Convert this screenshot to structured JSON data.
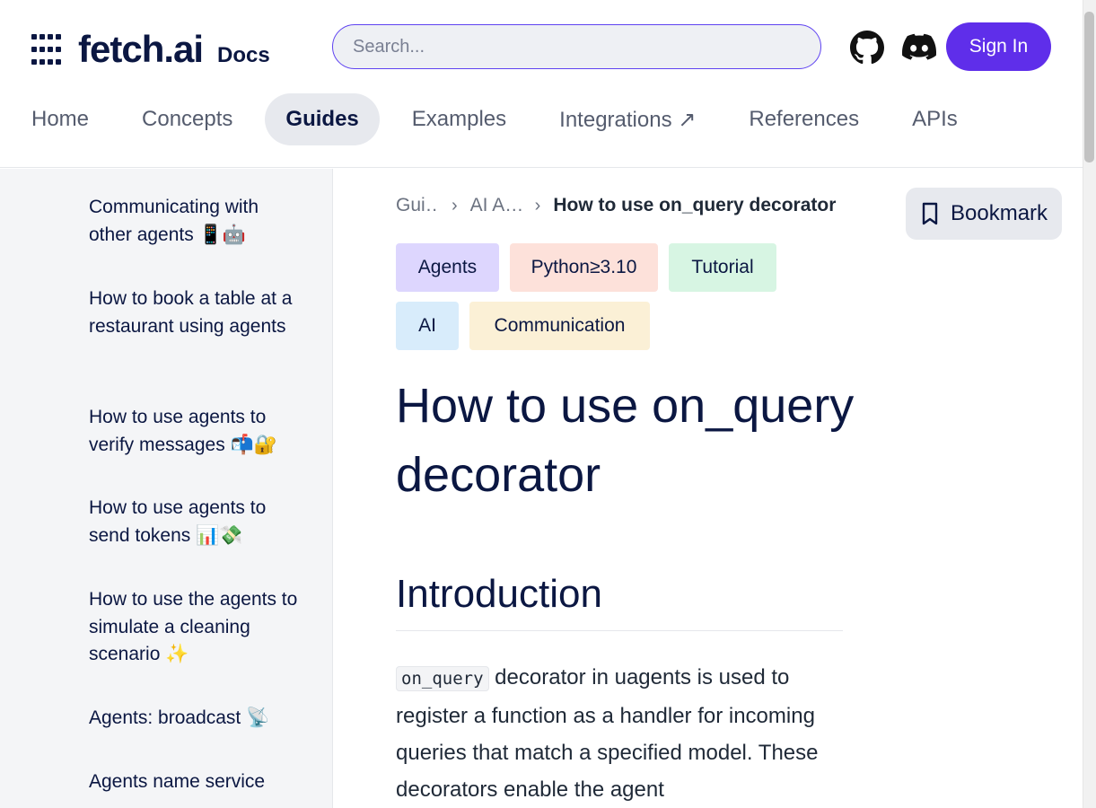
{
  "header": {
    "logo_text": "fetch.ai",
    "logo_suffix": "Docs",
    "search_placeholder": "Search...",
    "sign_in": "Sign In"
  },
  "nav": [
    "Home",
    "Concepts",
    "Guides",
    "Examples",
    "Integrations ↗",
    "References",
    "APIs"
  ],
  "nav_active": "Guides",
  "sidebar": {
    "items": [
      "Communicating with other agents 📱🤖",
      "How to book a table at a restaurant using agents",
      "How to use agents to verify messages 📬🔐",
      "How to use agents to send tokens 📊💸",
      "How to use the agents to simulate a cleaning scenario ✨",
      "Agents: broadcast 📡",
      "Agents name service"
    ]
  },
  "breadcrumb": {
    "items": [
      "Gui…",
      "AI A…",
      "How to use on_query decorator"
    ]
  },
  "bookmark_label": "Bookmark",
  "tags": [
    {
      "label": "Agents",
      "color": "#ddd6fe"
    },
    {
      "label": "Python≥3.10",
      "color": "#fde1da"
    },
    {
      "label": "Tutorial",
      "color": "#d7f5e3"
    },
    {
      "label": "AI",
      "color": "#d8ecfb"
    },
    {
      "label": "Communication",
      "color": "#fbf0d6"
    }
  ],
  "content": {
    "title": "How to use on_query decorator",
    "section_heading": "Introduction",
    "intro_code": "on_query",
    "intro_text": " decorator in uagents is used to register a function as a handler for incoming queries that match a specified model. These decorators enable the agent"
  },
  "colors": {
    "brand": "#0b1742",
    "accent": "#5f2eea"
  }
}
